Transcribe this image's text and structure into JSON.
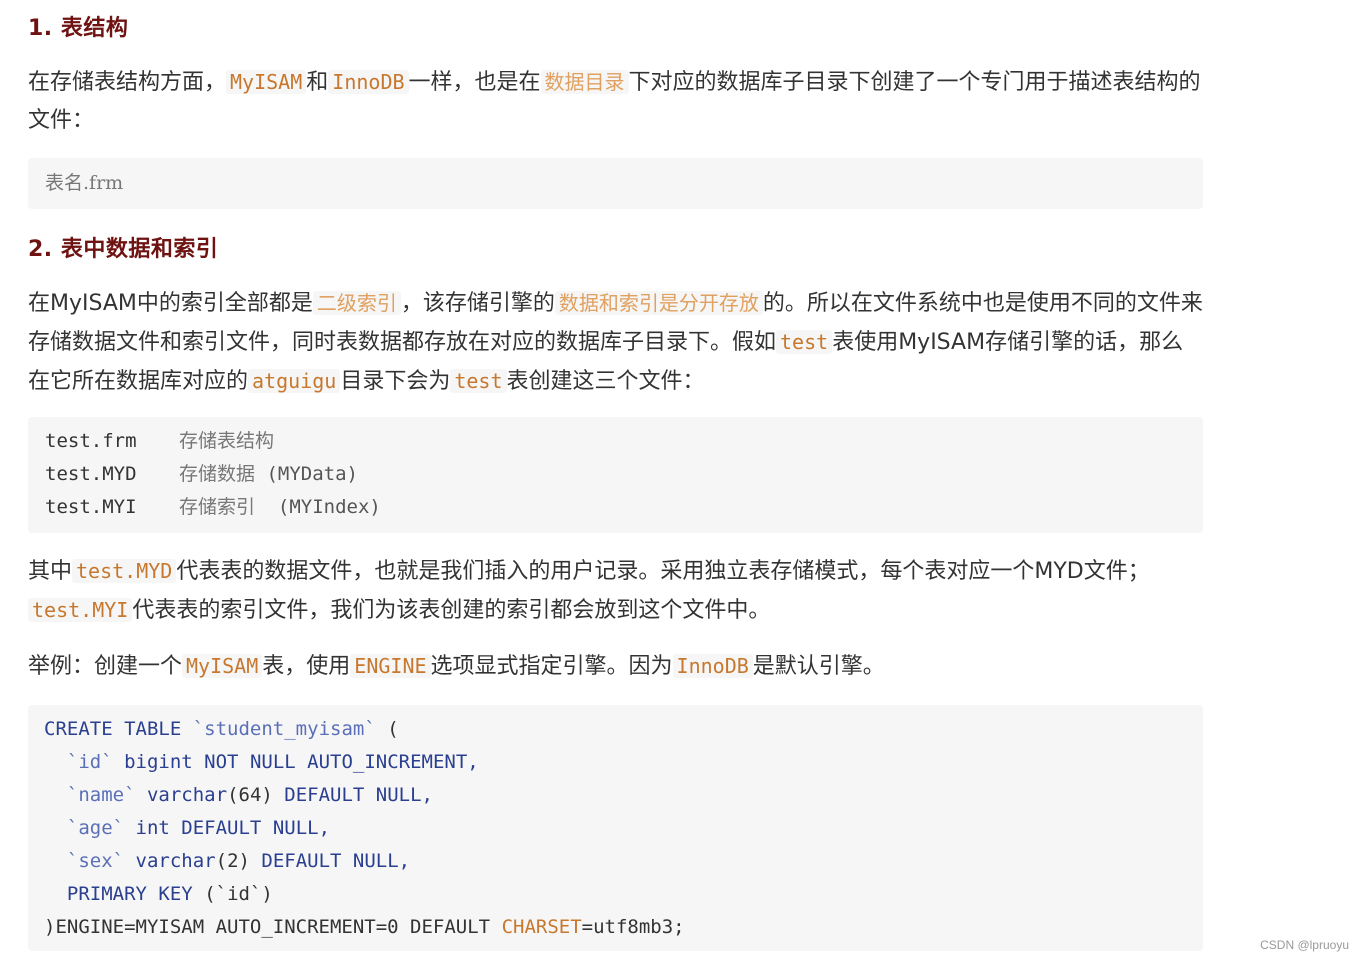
{
  "sec1": {
    "heading": "1. 表结构",
    "para": {
      "t1": "在存储表结构方面，",
      "c1": "MyISAM",
      "t2": "和",
      "c2": "InnoDB",
      "t3": "一样，也是在",
      "c3": "数据目录",
      "t4": "下对应的数据库子目录下创建了一个专门用于描述表结构的文件："
    },
    "code": "表名.frm"
  },
  "sec2": {
    "heading": "2. 表中数据和索引",
    "para1": {
      "t1": "在MyISAM中的索引全部都是",
      "c1": "二级索引",
      "t2": "，该存储引擎的",
      "c2": "数据和索引是分开存放",
      "t3": "的。所以在文件系统中也是使用不同的文件来存储数据文件和索引文件，同时表数据都存放在对应的数据库子目录下。假如",
      "c3": "test",
      "t4": "表使用MyISAM存储引擎的话，那么在它所在数据库对应的",
      "c4": "atguigu",
      "t5": "目录下会为",
      "c5": "test",
      "t6": "表创建这三个文件："
    },
    "files": [
      {
        "name": "test.frm",
        "desc": "存储表结构",
        "paren": ""
      },
      {
        "name": "test.MYD",
        "desc": "存储数据",
        "paren": "(MYData)"
      },
      {
        "name": "test.MYI",
        "desc": "存储索引",
        "paren": "(MYIndex)"
      }
    ],
    "para2": {
      "t1": "其中",
      "c1": "test.MYD",
      "t2": "代表表的数据文件，也就是我们插入的用户记录。采用独立表存储模式，每个表对应一个MYD文件；",
      "c2": "test.MYI",
      "t3": "代表表的索引文件，我们为该表创建的索引都会放到这个文件中。"
    },
    "para3": {
      "t1": "举例：创建一个",
      "c1": "MyISAM",
      "t2": "表，使用",
      "c2": "ENGINE",
      "t3": "选项显式指定引擎。因为",
      "c3": "InnoDB",
      "t4": "是默认引擎。"
    },
    "sql": {
      "l1_kw": "CREATE TABLE",
      "l1_name": "`student_myisam`",
      "l1_rest": "(",
      "l2_col": "`id`",
      "l2_def": "bigint NOT NULL AUTO_INCREMENT,",
      "l3_col": "`name`",
      "l3_type": "varchar",
      "l3_p": "(64)",
      "l3_def": "DEFAULT NULL,",
      "l4_col": "`age`",
      "l4_def": "int DEFAULT NULL,",
      "l5_col": "`sex`",
      "l5_type": "varchar",
      "l5_p": "(2)",
      "l5_def": "DEFAULT NULL,",
      "l6_kw": "PRIMARY KEY",
      "l6_rest": "(`id`)",
      "l7_a": ")ENGINE=MYISAM AUTO_INCREMENT=0 DEFAULT",
      "l7_kw": "CHARSET",
      "l7_b": "=utf8mb3;"
    }
  },
  "watermark": "CSDN @lpruoyu"
}
